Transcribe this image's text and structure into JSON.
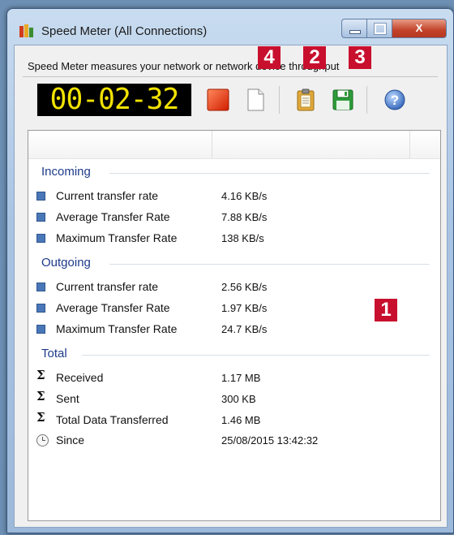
{
  "window": {
    "title": "Speed Meter (All Connections)",
    "close_glyph": "X",
    "buttons": [
      "minimize-icon",
      "maximize-icon",
      "close-icon"
    ]
  },
  "description": "Speed Meter measures your network or network device throughput",
  "timer": "00-02-32",
  "toolbar": {
    "icons": [
      "stop-icon",
      "new-document-icon",
      "clipboard-icon",
      "save-icon",
      "help-icon"
    ]
  },
  "markers": [
    "4",
    "2",
    "3",
    "1"
  ],
  "groups": {
    "incoming": {
      "heading": "Incoming",
      "rows": [
        {
          "label": "Current transfer rate",
          "value": "4.16 KB/s"
        },
        {
          "label": "Average Transfer Rate",
          "value": "7.88 KB/s"
        },
        {
          "label": "Maximum Transfer Rate",
          "value": "138 KB/s"
        }
      ]
    },
    "outgoing": {
      "heading": "Outgoing",
      "rows": [
        {
          "label": "Current transfer rate",
          "value": "2.56 KB/s"
        },
        {
          "label": "Average Transfer Rate",
          "value": "1.97 KB/s"
        },
        {
          "label": "Maximum Transfer Rate",
          "value": "24.7 KB/s"
        }
      ]
    },
    "total": {
      "heading": "Total",
      "sigma": "Σ",
      "rows": [
        {
          "label": "Received",
          "value": "1.17 MB"
        },
        {
          "label": "Sent",
          "value": "300 KB"
        },
        {
          "label": "Total Data Transferred",
          "value": "1.46 MB"
        },
        {
          "label": "Since",
          "value": "25/08/2015 13:42:32"
        }
      ]
    }
  },
  "colors": {
    "lcd_text": "#f2e200",
    "marker": "#c8102e",
    "group_heading": "#1e3a8a",
    "close_button": "#c2432a"
  }
}
